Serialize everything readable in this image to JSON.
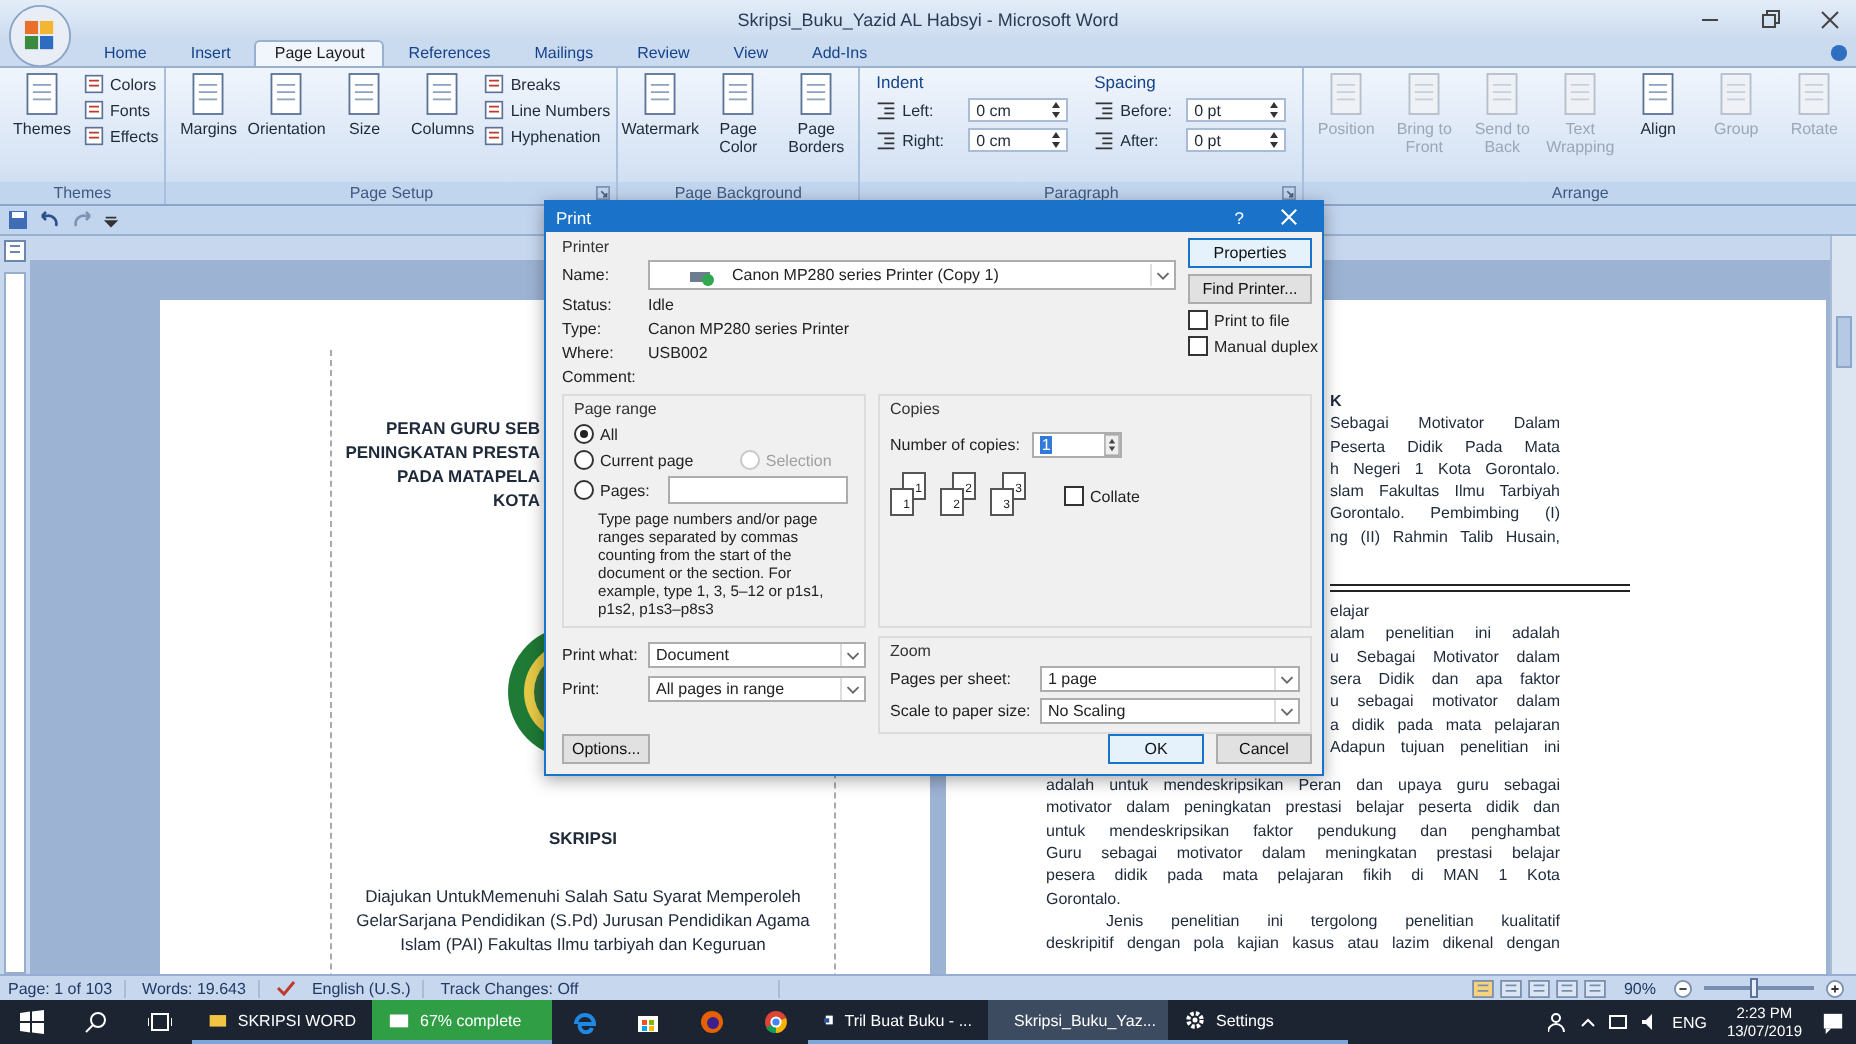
{
  "window": {
    "title": "Skripsi_Buku_Yazid AL Habsyi - Microsoft Word"
  },
  "ribbon": {
    "tabs": [
      {
        "label": "Home",
        "selected": false
      },
      {
        "label": "Insert",
        "selected": false
      },
      {
        "label": "Page Layout",
        "selected": true
      },
      {
        "label": "References",
        "selected": false
      },
      {
        "label": "Mailings",
        "selected": false
      },
      {
        "label": "Review",
        "selected": false
      },
      {
        "label": "View",
        "selected": false
      },
      {
        "label": "Add-Ins",
        "selected": false
      }
    ],
    "groups": [
      {
        "label": "Themes",
        "kind": "buttons",
        "launcher": false,
        "large": [
          {
            "label": "Themes",
            "disabled": false
          }
        ],
        "small": [
          {
            "label": "Colors"
          },
          {
            "label": "Fonts"
          },
          {
            "label": "Effects"
          }
        ]
      },
      {
        "label": "Page Setup",
        "kind": "buttons",
        "launcher": true,
        "large": [
          {
            "label": "Margins",
            "disabled": false
          },
          {
            "label": "Orientation",
            "disabled": false
          },
          {
            "label": "Size",
            "disabled": false
          },
          {
            "label": "Columns",
            "disabled": false
          }
        ],
        "small": [
          {
            "label": "Breaks"
          },
          {
            "label": "Line Numbers"
          },
          {
            "label": "Hyphenation"
          }
        ]
      },
      {
        "label": "Page Background",
        "kind": "buttons",
        "launcher": false,
        "large": [
          {
            "label": "Watermark",
            "disabled": false
          },
          {
            "label": "Page Color",
            "disabled": false
          },
          {
            "label": "Page Borders",
            "disabled": false
          }
        ]
      },
      {
        "label": "Paragraph",
        "kind": "fields",
        "launcher": true,
        "sections": [
          {
            "heading": "Indent",
            "rows": [
              {
                "label": "Left:",
                "value": "0 cm"
              },
              {
                "label": "Right:",
                "value": "0 cm"
              }
            ]
          },
          {
            "heading": "Spacing",
            "rows": [
              {
                "label": "Before:",
                "value": "0 pt"
              },
              {
                "label": "After:",
                "value": "0 pt"
              }
            ]
          }
        ]
      },
      {
        "label": "Arrange",
        "kind": "buttons",
        "launcher": false,
        "large": [
          {
            "label": "Position",
            "disabled": true
          },
          {
            "label": "Bring to Front",
            "disabled": true
          },
          {
            "label": "Send to Back",
            "disabled": true
          },
          {
            "label": "Text Wrapping",
            "disabled": true
          },
          {
            "label": "Align",
            "disabled": false
          },
          {
            "label": "Group",
            "disabled": true
          },
          {
            "label": "Rotate",
            "disabled": true
          }
        ]
      }
    ]
  },
  "left_page": {
    "title_lines": [
      "PERAN GURU SEB",
      "PENINGKATAN PRESTA",
      "PADA MATAPELA",
      "KOTA"
    ],
    "heading": "SKRIPSI",
    "paragraph": "Diajukan UntukMemenuhi Salah Satu Syarat Memperoleh GelarSarjana Pendidikan (S.Pd) Jurusan Pendidikan Agama Islam (PAI) Fakultas Ilmu tarbiyah dan Keguruan"
  },
  "right_page": {
    "upper_lines": [
      {
        "text": "K",
        "kind": "heading"
      },
      {
        "text": "Sebagai Motivator Dalam",
        "kind": "text"
      },
      {
        "text": "Peserta Didik Pada Mata",
        "kind": "text"
      },
      {
        "text": "h Negeri 1 Kota Gorontalo.",
        "kind": "text"
      },
      {
        "text": "slam Fakultas Ilmu Tarbiyah",
        "kind": "text"
      },
      {
        "text": "Gorontalo. Pembimbing (I)",
        "kind": "text"
      },
      {
        "text": "ng (II) Rahmin Talib Husain,",
        "kind": "text"
      }
    ],
    "side_lines": [
      {
        "text": "elajar",
        "kind": "last"
      },
      {
        "text": "alam penelitian ini adalah",
        "kind": "text"
      },
      {
        "text": "u Sebagai Motivator dalam",
        "kind": "text"
      },
      {
        "text": "sera Didik dan apa faktor",
        "kind": "text"
      },
      {
        "text": "u sebagai motivator dalam",
        "kind": "text"
      },
      {
        "text": "a didik pada mata pelajaran",
        "kind": "text"
      },
      {
        "text": "Adapun tujuan penelitian ini",
        "kind": "text"
      }
    ],
    "lines": [
      {
        "text": "adalah untuk mendeskripsikan Peran dan upaya guru sebagai",
        "kind": "text"
      },
      {
        "text": "motivator dalam peningkatan prestasi belajar peserta didik dan",
        "kind": "text"
      },
      {
        "text": "untuk mendeskripsikan faktor pendukung dan penghambat",
        "kind": "text"
      },
      {
        "text": "Guru sebagai motivator dalam meningkatan prestasi belajar",
        "kind": "text"
      },
      {
        "text": "pesera didik pada mata pelajaran fikih di MAN 1 Kota",
        "kind": "text"
      },
      {
        "text": "Gorontalo.",
        "kind": "last"
      },
      {
        "text": "Jenis penelitian ini tergolong penelitian kualitatif",
        "kind": "indent"
      },
      {
        "text": "deskripitif dengan pola kajian kasus atau lazim dikenal dengan",
        "kind": "text"
      }
    ]
  },
  "print_dialog": {
    "title": "Print",
    "help": "?",
    "printer": {
      "legend": "Printer",
      "name_label": "Name:",
      "name": "Canon MP280 series Printer (Copy 1)",
      "info": [
        {
          "label": "Status:",
          "value": "Idle"
        },
        {
          "label": "Type:",
          "value": "Canon MP280 series Printer"
        },
        {
          "label": "Where:",
          "value": "USB002"
        },
        {
          "label": "Comment:"
        }
      ],
      "buttons": [
        "Properties",
        "Find Printer..."
      ],
      "checkboxes": [
        {
          "label": "Print to file",
          "checked": false
        },
        {
          "label": "Manual duplex",
          "checked": false
        }
      ]
    },
    "page_range": {
      "legend": "Page range",
      "options": [
        {
          "label": "All",
          "selected": true,
          "disabled": false
        },
        {
          "label": "Current page",
          "selected": false,
          "disabled": false
        },
        {
          "label": "Selection",
          "selected": false,
          "disabled": true
        },
        {
          "label": "Pages:",
          "selected": false,
          "disabled": false
        }
      ],
      "help": "Type page numbers and/or page ranges separated by commas counting from the start of the document or the section. For example, type 1, 3, 5–12 or p1s1, p1s2, p1s3–p8s3"
    },
    "copies": {
      "legend": "Copies",
      "label": "Number of copies:",
      "value": "1",
      "stacks": [
        [
          "1",
          "1"
        ],
        [
          "2",
          "2"
        ],
        [
          "3",
          "3"
        ]
      ],
      "collate": {
        "label": "Collate",
        "checked": false
      }
    },
    "selects": [
      {
        "label": "Print what:",
        "value": "Document"
      },
      {
        "label": "Print:",
        "value": "All pages in range"
      }
    ],
    "zoom": {
      "legend": "Zoom",
      "rows": [
        {
          "label": "Pages per sheet:",
          "value": "1 page"
        },
        {
          "label": "Scale to paper size:",
          "value": "No Scaling"
        }
      ]
    },
    "options_button": "Options...",
    "ok": "OK",
    "cancel": "Cancel"
  },
  "status_bar": {
    "page": "Page: 1 of 103",
    "words": "Words: 19.643",
    "language": "English (U.S.)",
    "track_changes": "Track Changes: Off",
    "zoom": "90%",
    "zoom_slider": {
      "level": 0.45
    }
  },
  "taskbar": {
    "left_buttons": [
      {
        "label": "SKRIPSI WORD",
        "kind": "folder"
      },
      {
        "label": "67% complete",
        "kind": "progress"
      }
    ],
    "right_buttons": [
      {
        "label": "Tril Buat Buku - ...",
        "selected": false,
        "kind": "doc"
      },
      {
        "label": "Skripsi_Buku_Yaz...",
        "selected": true,
        "kind": "doc"
      },
      {
        "label": "Settings",
        "selected": false,
        "kind": "gear"
      }
    ],
    "language": "ENG",
    "time": "2:23 PM",
    "date": "13/07/2019"
  }
}
